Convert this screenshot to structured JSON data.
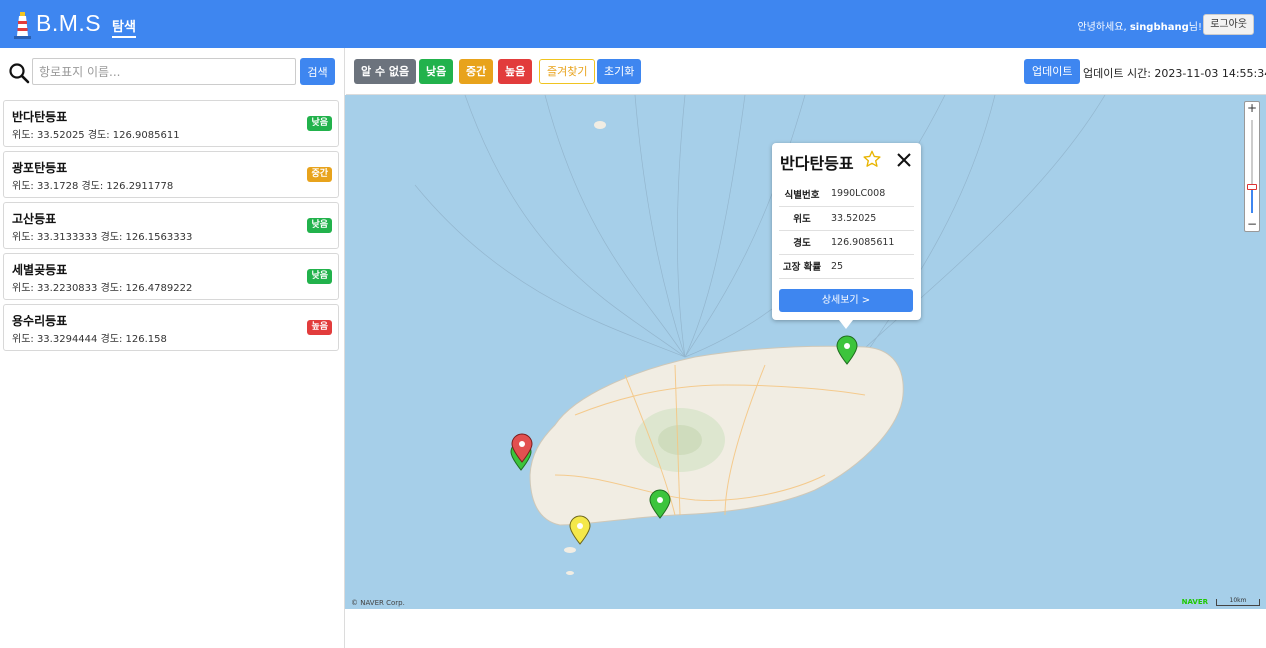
{
  "header": {
    "brand": "B.M.S",
    "nav_explore": "탐색",
    "greeting_prefix": "안녕하세요, ",
    "username": "singbhang",
    "greeting_suffix": "님!",
    "logout_label": "로그아웃"
  },
  "search": {
    "placeholder": "항로표지 이름...",
    "button_label": "검색"
  },
  "buoys": [
    {
      "name": "반다탄등표",
      "coords": "위도: 33.52025 경도: 126.9085611",
      "status": "낮음",
      "status_color": "#22b24c"
    },
    {
      "name": "광포탄등표",
      "coords": "위도: 33.1728 경도: 126.2911778",
      "status": "중간",
      "status_color": "#e8a31c"
    },
    {
      "name": "고산등표",
      "coords": "위도: 33.3133333 경도: 126.1563333",
      "status": "낮음",
      "status_color": "#22b24c"
    },
    {
      "name": "세별곶등표",
      "coords": "위도: 33.2230833 경도: 126.4789222",
      "status": "낮음",
      "status_color": "#22b24c"
    },
    {
      "name": "용수리등표",
      "coords": "위도: 33.3294444 경도: 126.158",
      "status": "높음",
      "status_color": "#e23c3c"
    }
  ],
  "filters": {
    "unknown": "알 수 없음",
    "low": "낮음",
    "medium": "중간",
    "high": "높음",
    "favorites": "즐겨찾기",
    "reset": "초기화"
  },
  "colors": {
    "primary": "#3e86f0",
    "unknown": "#6c737d",
    "low": "#22b24c",
    "medium": "#e8a31c",
    "high": "#e23c3c",
    "favorites_border": "#f0c420"
  },
  "update": {
    "button_label": "업데이트",
    "time_text": "업데이트 시간: 2023-11-03 14:55:34"
  },
  "popup": {
    "title": "반다탄등표",
    "rows": [
      {
        "key": "식별번호",
        "value": "1990LC008"
      },
      {
        "key": "위도",
        "value": "33.52025"
      },
      {
        "key": "경도",
        "value": "126.9085611"
      },
      {
        "key": "고장 확률",
        "value": "25"
      }
    ],
    "detail_button": "상세보기 >"
  },
  "map": {
    "attribution": "© NAVER Corp.",
    "naver_logo": "NAVER",
    "scale_label": "10km",
    "zoom_in": "+",
    "zoom_out": "−"
  }
}
